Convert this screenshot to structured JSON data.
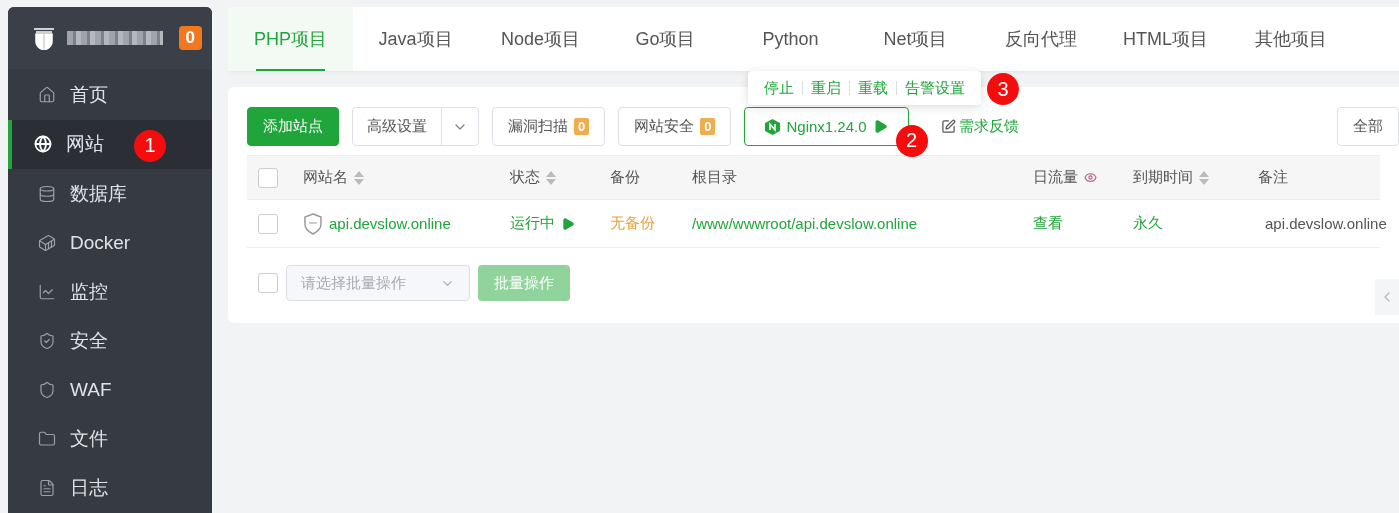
{
  "sidebar": {
    "brand": {
      "badge": "0"
    },
    "items": [
      {
        "label": "首页",
        "selected": false
      },
      {
        "label": "网站",
        "selected": true
      },
      {
        "label": "数据库",
        "selected": false
      },
      {
        "label": "Docker",
        "selected": false
      },
      {
        "label": "监控",
        "selected": false
      },
      {
        "label": "安全",
        "selected": false
      },
      {
        "label": "WAF",
        "selected": false
      },
      {
        "label": "文件",
        "selected": false
      },
      {
        "label": "日志",
        "selected": false
      }
    ]
  },
  "tabs": [
    {
      "label": "PHP项目",
      "selected": true
    },
    {
      "label": "Java项目",
      "selected": false
    },
    {
      "label": "Node项目",
      "selected": false
    },
    {
      "label": "Go项目",
      "selected": false
    },
    {
      "label": "Python",
      "selected": false
    },
    {
      "label": "Net项目",
      "selected": false
    },
    {
      "label": "反向代理",
      "selected": false
    },
    {
      "label": "HTML项目",
      "selected": false
    },
    {
      "label": "其他项目",
      "selected": false
    }
  ],
  "popover": {
    "items": [
      "停止",
      "重启",
      "重载",
      "告警设置"
    ]
  },
  "toolbar": {
    "add_button": "添加站点",
    "settings_dropdown": "高级设置",
    "scan_button": {
      "label": "漏洞扫描",
      "badge": "0"
    },
    "security_button": {
      "label": "网站安全",
      "badge": "0"
    },
    "server_button": {
      "label": "Nginx1.24.0"
    },
    "feedback_link": "需求反馈",
    "filter_button": "全部"
  },
  "table": {
    "select_all_checked": false,
    "columns": [
      {
        "label": "网站名",
        "sortable": true,
        "kind": "text"
      },
      {
        "label": "状态",
        "sortable": true,
        "kind": "text"
      },
      {
        "label": "备份",
        "sortable": false,
        "kind": "text"
      },
      {
        "label": "根目录",
        "sortable": false,
        "kind": "text"
      },
      {
        "label": "日流量",
        "sortable": false,
        "kind": "eye"
      },
      {
        "label": "到期时间",
        "sortable": true,
        "kind": "text"
      },
      {
        "label": "备注",
        "sortable": false,
        "kind": "text"
      }
    ],
    "rows": [
      {
        "checked": false,
        "name": "api.devslow.online",
        "status": "运行中",
        "backup": "无备份",
        "root": "/www/wwwroot/api.devslow.online",
        "traffic": "查看",
        "expiry": "永久",
        "note": "api.devslow.online"
      }
    ]
  },
  "footer": {
    "checked": false,
    "batch_select": {
      "placeholder": "请选择批量操作"
    },
    "batch_button": {
      "label": "批量操作",
      "disabled": true
    }
  },
  "annotations": [
    {
      "label": "1",
      "kind": "sidebar"
    },
    {
      "label": "2",
      "kind": "server"
    },
    {
      "label": "3",
      "kind": "popover"
    }
  ]
}
